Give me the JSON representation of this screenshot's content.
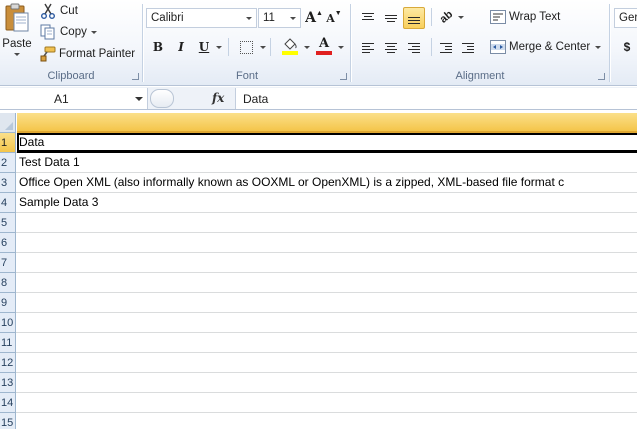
{
  "ribbon": {
    "clipboard": {
      "label": "Clipboard",
      "paste": "Paste",
      "cut": "Cut",
      "copy": "Copy",
      "format_painter": "Format Painter"
    },
    "font": {
      "label": "Font",
      "font_name": "Calibri",
      "font_size": "11",
      "bold": "B",
      "italic": "I",
      "underline": "U",
      "grow_font": "A",
      "shrink_font": "A",
      "font_color": "A"
    },
    "alignment": {
      "label": "Alignment",
      "wrap_text": "Wrap Text",
      "merge_center": "Merge & Center"
    },
    "number": {
      "format": "Ger",
      "currency": "$"
    }
  },
  "formula_bar": {
    "name_box": "A1",
    "fx": "fx",
    "formula": "Data"
  },
  "sheet": {
    "rows": [
      {
        "num": "1",
        "a": "Data"
      },
      {
        "num": "2",
        "a": "Test Data 1"
      },
      {
        "num": "3",
        "a": "Office Open XML (also informally known as OOXML or OpenXML) is a zipped, XML-based file format c"
      },
      {
        "num": "4",
        "a": "Sample Data 3"
      },
      {
        "num": "5",
        "a": ""
      },
      {
        "num": "6",
        "a": ""
      },
      {
        "num": "7",
        "a": ""
      },
      {
        "num": "8",
        "a": ""
      },
      {
        "num": "9",
        "a": ""
      },
      {
        "num": "10",
        "a": ""
      },
      {
        "num": "11",
        "a": ""
      },
      {
        "num": "12",
        "a": ""
      },
      {
        "num": "13",
        "a": ""
      },
      {
        "num": "14",
        "a": ""
      },
      {
        "num": "15",
        "a": ""
      }
    ]
  },
  "colors": {
    "selection": "#f4c54a",
    "font_color_bar": "#e02020",
    "highlight_bar": "#ffff00"
  }
}
